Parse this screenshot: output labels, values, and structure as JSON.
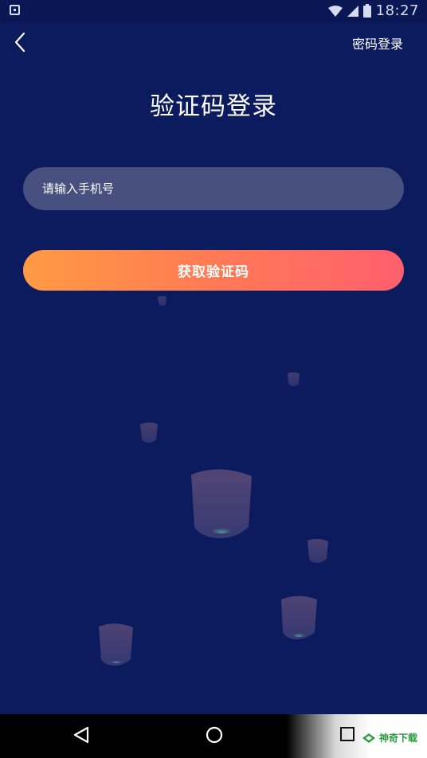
{
  "status_bar": {
    "time": "18:27"
  },
  "header": {
    "right_link": "密码登录"
  },
  "title": "验证码登录",
  "phone_input": {
    "placeholder": "请输入手机号",
    "value": ""
  },
  "get_code_button": {
    "label": "获取验证码"
  },
  "watermark": {
    "text": "神奇下载"
  },
  "colors": {
    "background": "#0c1a5e",
    "input_bg": "#47507f",
    "button_gradient_start": "#ff9a43",
    "button_gradient_end": "#ff5f6d"
  }
}
